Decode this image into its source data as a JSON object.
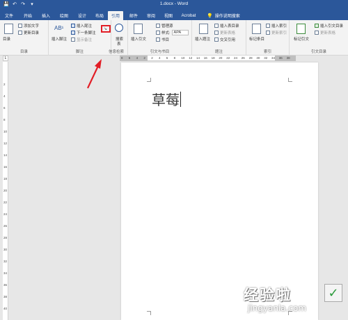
{
  "window": {
    "title": "1.docx  -  Word",
    "quick_access": {
      "save": "💾",
      "undo": "↶",
      "redo": "↷",
      "more": "▾"
    }
  },
  "tabs": [
    "文件",
    "开始",
    "插入",
    "绘图",
    "设计",
    "布局",
    "引用",
    "邮件",
    "审阅",
    "视图",
    "Acrobat"
  ],
  "active_tab": "引用",
  "tell_me": "操作说明搜索",
  "ribbon": {
    "toc": {
      "label": "目录",
      "big_button": "目录",
      "add_text": "添加文字",
      "update_toc": "更新目录"
    },
    "footnotes": {
      "label": "脚注",
      "big_button": "插入脚注",
      "ab_glyph": "AB¹",
      "insert_endnote": "插入尾注",
      "next_footnote": "下一条脚注",
      "show_notes": "显示备注"
    },
    "research": {
      "label": "信息检索",
      "big_button": "搜索",
      "big_button_line2": "表"
    },
    "citations": {
      "label": "引文与书目",
      "big_button": "插入引文",
      "manage_sources": "管理源",
      "style_label": "样式:",
      "style_value": "APA",
      "bibliography": "书目"
    },
    "captions": {
      "label": "题注",
      "big_button": "插入题注",
      "insert_table_of_figures": "插入表目录",
      "update_table": "更新表格",
      "cross_reference": "交叉引用"
    },
    "index": {
      "label": "索引",
      "big_button": "标记条目",
      "insert_index": "插入索引",
      "update_index": "更新索引"
    },
    "toa": {
      "label": "引文目录",
      "big_button": "标记引文",
      "insert_toa": "插入引文目录",
      "update_table": "更新表格"
    }
  },
  "ruler": {
    "h_numbers": [
      "8",
      "6",
      "4",
      "2",
      "2",
      "4",
      "6",
      "8",
      "10",
      "12",
      "14",
      "16",
      "18",
      "20",
      "22",
      "24",
      "26",
      "28",
      "30",
      "32",
      "34",
      "36",
      "38"
    ],
    "v_numbers": [
      "2",
      "4",
      "6",
      "8",
      "10",
      "12",
      "14",
      "16",
      "18",
      "20",
      "22",
      "24",
      "26",
      "28",
      "30",
      "32",
      "34",
      "36",
      "38",
      "40"
    ],
    "corner": "L"
  },
  "document": {
    "text": "草莓"
  },
  "watermark": {
    "main": "经验啦",
    "url": "jingyanla.com",
    "check": "✓"
  },
  "colors": {
    "brand": "#2b579a",
    "ribbon_bg": "#f3f3f3",
    "highlight": "#e21e26"
  }
}
